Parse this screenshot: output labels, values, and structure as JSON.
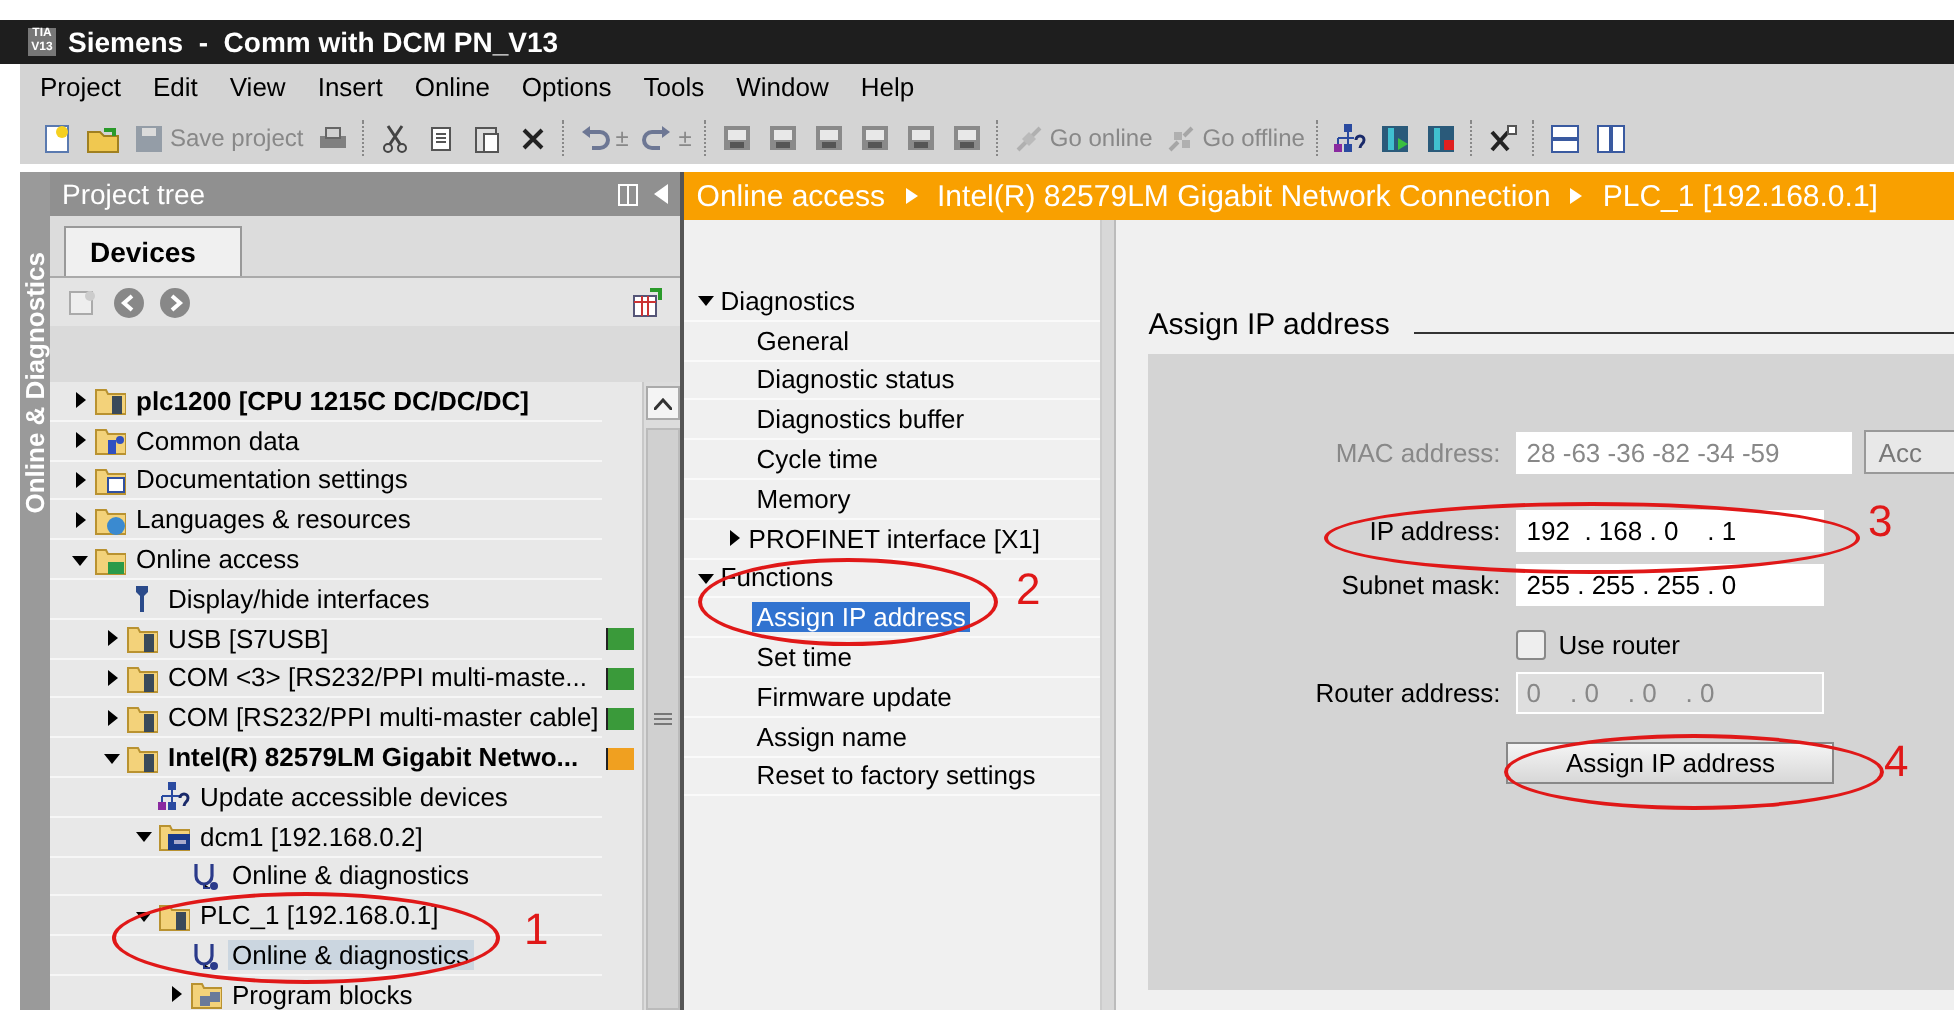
{
  "window": {
    "logo": [
      "TIA",
      "V13"
    ],
    "title": "Siemens  -  Comm with DCM PN_V13"
  },
  "menu": [
    "Project",
    "Edit",
    "View",
    "Insert",
    "Online",
    "Options",
    "Tools",
    "Window",
    "Help"
  ],
  "toolbar": [
    {
      "kind": "new"
    },
    {
      "kind": "open"
    },
    {
      "kind": "save",
      "label": "Save project",
      "disabled": true
    },
    {
      "kind": "print"
    },
    {
      "kind": "sep"
    },
    {
      "kind": "cut"
    },
    {
      "kind": "copy"
    },
    {
      "kind": "paste"
    },
    {
      "kind": "delete"
    },
    {
      "kind": "sep"
    },
    {
      "kind": "undo",
      "label": "±",
      "disabled": true
    },
    {
      "kind": "redo",
      "label": "±",
      "disabled": true
    },
    {
      "kind": "sep"
    },
    {
      "kind": "compile"
    },
    {
      "kind": "device"
    },
    {
      "kind": "download"
    },
    {
      "kind": "upload"
    },
    {
      "kind": "monitor"
    },
    {
      "kind": "sim"
    },
    {
      "kind": "sep"
    },
    {
      "kind": "online",
      "label": "Go online",
      "disabled": true
    },
    {
      "kind": "offline",
      "label": "Go offline",
      "disabled": true
    },
    {
      "kind": "sep"
    },
    {
      "kind": "network"
    },
    {
      "kind": "start"
    },
    {
      "kind": "stop"
    },
    {
      "kind": "sep"
    },
    {
      "kind": "close"
    },
    {
      "kind": "sep"
    },
    {
      "kind": "split-h"
    },
    {
      "kind": "split-v"
    }
  ],
  "side_tab": "Online & Diagnostics",
  "project_tree": {
    "title": "Project tree",
    "tab": "Devices",
    "items": [
      {
        "label": "plc1200 [CPU 1215C DC/DC/DC]",
        "kind": "device",
        "bold": true,
        "expanded": false,
        "selected": false
      },
      {
        "label": "Common data",
        "kind": "data",
        "bold": false,
        "expanded": false,
        "selected": false
      },
      {
        "label": "Documentation settings",
        "kind": "docs",
        "bold": false,
        "expanded": false,
        "selected": false
      },
      {
        "label": "Languages & resources",
        "kind": "globe",
        "bold": false,
        "expanded": false,
        "selected": false
      },
      {
        "label": "Online access",
        "kind": "online",
        "bold": false,
        "expanded": true,
        "selected": false,
        "children": [
          {
            "label": "Display/hide interfaces",
            "kind": "wrench",
            "bold": false,
            "selected": false
          },
          {
            "label": "USB [S7USB]",
            "kind": "device",
            "bold": false,
            "expanded": false,
            "selected": false,
            "color": "#3a9a3a"
          },
          {
            "label": "COM <3> [RS232/PPI multi-maste...",
            "kind": "device",
            "bold": false,
            "expanded": false,
            "selected": false,
            "color": "#3a9a3a"
          },
          {
            "label": "COM [RS232/PPI multi-master cable]",
            "kind": "device",
            "bold": false,
            "expanded": false,
            "selected": false,
            "color": "#3a9a3a"
          },
          {
            "label": "Intel(R) 82579LM Gigabit Netwo...",
            "kind": "device",
            "bold": true,
            "expanded": true,
            "selected": false,
            "color": "#f0a020",
            "children": [
              {
                "label": "Update accessible devices",
                "kind": "network",
                "bold": false,
                "selected": false
              },
              {
                "label": "dcm1 [192.168.0.2]",
                "kind": "module",
                "bold": false,
                "expanded": true,
                "selected": false,
                "children": [
                  {
                    "label": "Online & diagnostics",
                    "kind": "diag",
                    "bold": false,
                    "selected": false
                  }
                ]
              },
              {
                "label": "PLC_1 [192.168.0.1]",
                "kind": "device",
                "bold": false,
                "expanded": true,
                "selected": false,
                "children": [
                  {
                    "label": "Online & diagnostics",
                    "kind": "diag",
                    "bold": false,
                    "selected": true
                  },
                  {
                    "label": "Program blocks",
                    "kind": "blocks",
                    "bold": false,
                    "expanded": false,
                    "selected": false
                  }
                ]
              }
            ]
          }
        ]
      }
    ]
  },
  "breadcrumb": [
    "Online access",
    "Intel(R) 82579LM Gigabit Network Connection",
    "PLC_1 [192.168.0.1]"
  ],
  "nav": [
    {
      "label": "Diagnostics",
      "expanded": true,
      "children": [
        {
          "label": "General",
          "selected": false
        },
        {
          "label": "Diagnostic status",
          "selected": false
        },
        {
          "label": "Diagnostics buffer",
          "selected": false
        },
        {
          "label": "Cycle time",
          "selected": false
        },
        {
          "label": "Memory",
          "selected": false
        },
        {
          "label": "PROFINET interface [X1]",
          "selected": false,
          "expanded": false
        }
      ]
    },
    {
      "label": "Functions",
      "expanded": true,
      "children": [
        {
          "label": "Assign IP address",
          "selected": true
        },
        {
          "label": "Set time",
          "selected": false
        },
        {
          "label": "Firmware update",
          "selected": false
        },
        {
          "label": "Assign name",
          "selected": false
        },
        {
          "label": "Reset to factory settings",
          "selected": false
        }
      ]
    }
  ],
  "section": {
    "title": "Assign IP address",
    "mac": {
      "label": "MAC address:",
      "value": "28 -63 -36 -82 -34 -59",
      "disabled": true,
      "button": "Acc"
    },
    "ip": {
      "label": "IP address:",
      "value": "192  . 168 . 0    . 1",
      "disabled": false
    },
    "mask": {
      "label": "Subnet mask:",
      "value": "255 . 255 . 255 . 0",
      "disabled": false
    },
    "use_router": {
      "label": "Use router",
      "checked": false
    },
    "router": {
      "label": "Router address:",
      "value": "0    . 0    . 0    . 0",
      "disabled": true
    },
    "button": "Assign IP address"
  },
  "annotations": [
    {
      "label": "1"
    },
    {
      "label": "2"
    },
    {
      "label": "3"
    },
    {
      "label": "4"
    }
  ]
}
